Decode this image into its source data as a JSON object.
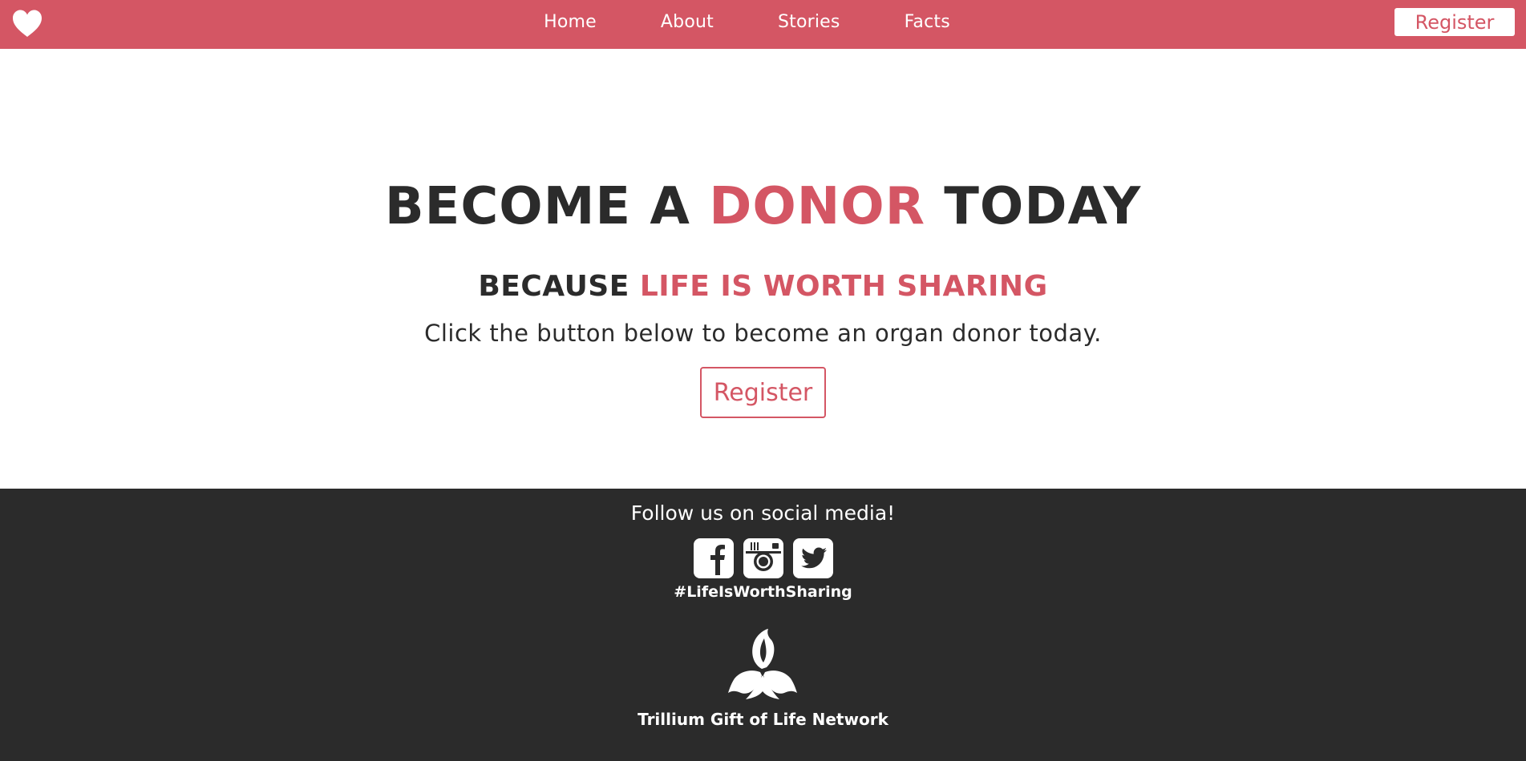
{
  "nav": {
    "links": [
      "Home",
      "About",
      "Stories",
      "Facts"
    ],
    "register_label": "Register"
  },
  "hero": {
    "title_part1": "BECOME A ",
    "title_accent": "DONOR",
    "title_part2": " TODAY",
    "subtitle_part1": "BECAUSE ",
    "subtitle_accent": "LIFE IS WORTH SHARING",
    "description": "Click the button below to become an organ donor today.",
    "register_label": "Register"
  },
  "footer": {
    "follow_text": "Follow us on social media!",
    "hashtag": "#LifeIsWorthSharing",
    "organization": "Trillium Gift of Life Network"
  },
  "colors": {
    "accent": "#d45664",
    "dark": "#2b2b2b",
    "white": "#ffffff"
  },
  "icons": [
    "heart-icon",
    "facebook-icon",
    "instagram-icon",
    "twitter-icon",
    "trillium-logo"
  ]
}
